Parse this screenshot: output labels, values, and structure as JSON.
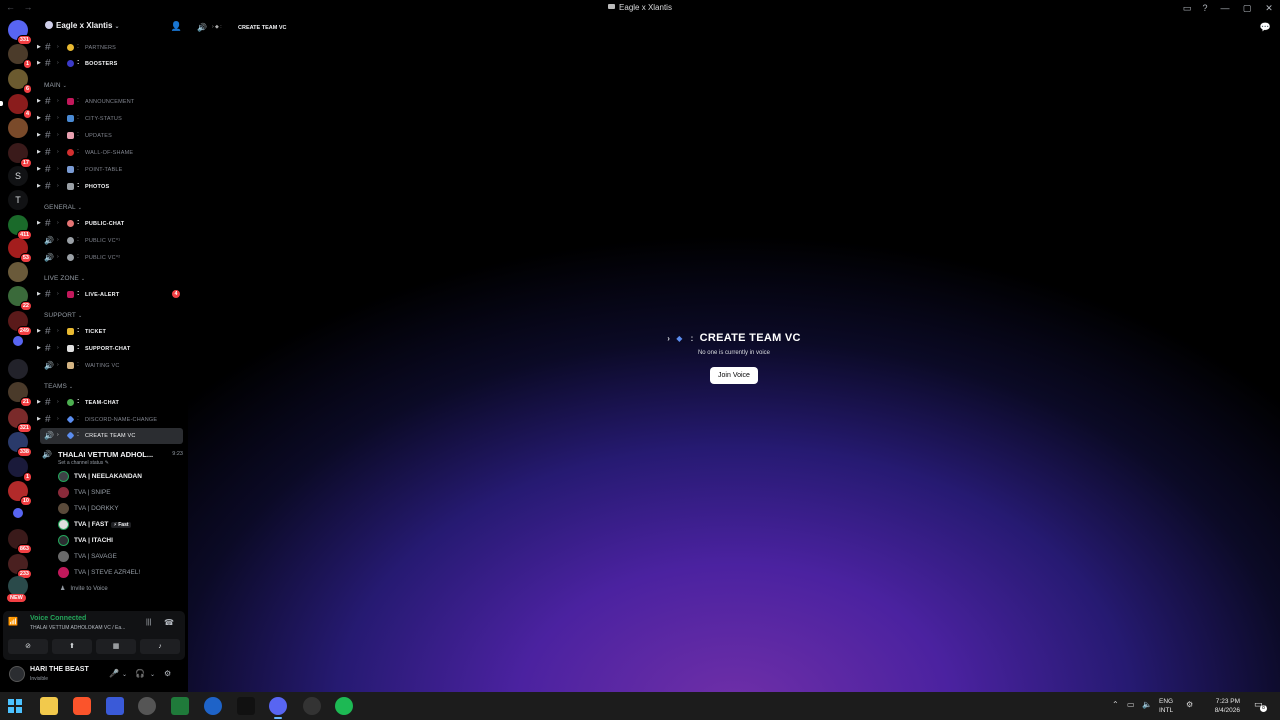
{
  "window": {
    "title": "Eagle x Xlantis",
    "nav_arrows": "← →",
    "buttons": [
      "▭",
      "?",
      "—",
      "▢",
      "✕"
    ]
  },
  "rail": {
    "badges": [
      "331",
      "1",
      "6",
      "4",
      "17",
      "",
      "",
      "411",
      "53",
      "",
      "22",
      "249",
      "",
      "",
      "21",
      "321",
      "338",
      "1",
      "10",
      "",
      "863",
      "233",
      ""
    ],
    "letters": [
      "T"
    ],
    "new_label": "NEW"
  },
  "sidebar": {
    "guild_name": "Eagle x Xlantis",
    "channels_top": [
      {
        "name": "partners",
        "bold": false
      },
      {
        "name": "boosters",
        "bold": true
      }
    ],
    "categories": [
      {
        "name": "MAIN",
        "channels": [
          {
            "name": "announcement",
            "type": "text",
            "bold": false
          },
          {
            "name": "city-status",
            "type": "text",
            "bold": false
          },
          {
            "name": "updates",
            "type": "text",
            "bold": false
          },
          {
            "name": "wall-of-shame",
            "type": "text",
            "bold": false
          },
          {
            "name": "point-table",
            "type": "text",
            "bold": false
          },
          {
            "name": "photos",
            "type": "text",
            "bold": true
          }
        ]
      },
      {
        "name": "GENERAL",
        "channels": [
          {
            "name": "public-chat",
            "type": "text",
            "bold": true
          },
          {
            "name": "public vc⁰¹",
            "type": "voice",
            "bold": false
          },
          {
            "name": "public vc⁰²",
            "type": "voice",
            "bold": false
          }
        ]
      },
      {
        "name": "LIVE ZONE",
        "channels": [
          {
            "name": "live-alert",
            "type": "text",
            "bold": true,
            "mentions": "4"
          }
        ]
      },
      {
        "name": "SUPPORT",
        "channels": [
          {
            "name": "ticket",
            "type": "text",
            "bold": true
          },
          {
            "name": "support-chat",
            "type": "text",
            "bold": true
          },
          {
            "name": "waiting vc",
            "type": "voice",
            "bold": false
          }
        ]
      },
      {
        "name": "TEAMS",
        "channels": [
          {
            "name": "team-chat",
            "type": "text",
            "bold": true
          },
          {
            "name": "discord-name-change",
            "type": "text",
            "bold": false
          },
          {
            "name": "create team vc",
            "type": "voice",
            "bold": false,
            "active": true
          }
        ]
      }
    ],
    "voice_channel": {
      "name": "THALAI VETTUM ADHOL...",
      "time": "9:23",
      "status": "Set a channel status ✎"
    },
    "members": [
      {
        "name": "TVA | NEELAKANDAN",
        "speaking": true
      },
      {
        "name": "TVA | SNIPE",
        "speaking": false
      },
      {
        "name": "TVA | DORKKY",
        "speaking": false
      },
      {
        "name": "TVA | FAST",
        "speaking": true,
        "tag": "⚡ Fast"
      },
      {
        "name": "TVA | ITACHI",
        "speaking": true
      },
      {
        "name": "TVA | SAVAGE",
        "speaking": false
      },
      {
        "name": "TVA | STEVE AZR4EL!",
        "speaking": false
      }
    ],
    "invite_label": "Invite to Voice"
  },
  "voice_panel": {
    "title": "Voice Connected",
    "subtitle": "THALAI VETTUM ADHOLOKAM VC / Ea..."
  },
  "user_panel": {
    "name": "HARI THE BEAST",
    "status": "Invisible"
  },
  "main": {
    "header_channel": "CREATE TEAM VC",
    "center_title": "CREATE TEAM VC",
    "center_subtitle": "No one is currently in voice",
    "join_label": "Join Voice"
  },
  "taskbar": {
    "lang_line1": "ENG",
    "lang_line2": "INTL",
    "time": "7:23 PM",
    "date": "8/4/2026",
    "notification_count": "8"
  },
  "colors": {
    "accent_green": "#23a55a",
    "mention_red": "#f23f43",
    "blurple": "#5865f2"
  }
}
